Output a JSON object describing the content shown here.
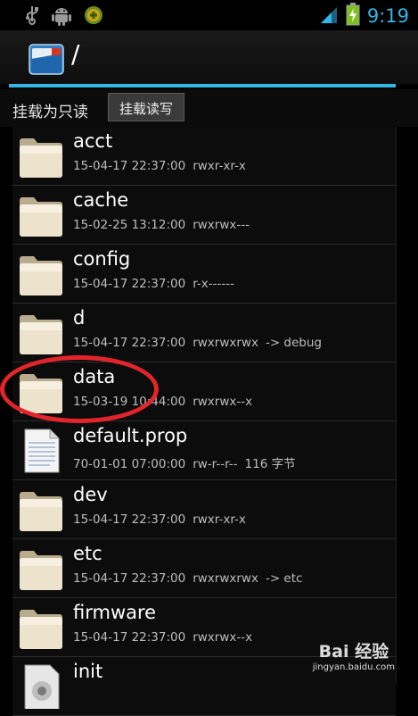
{
  "status_bar": {
    "time": "9:19",
    "left_icons": [
      "usb-icon",
      "android-debug-icon",
      "app-notification-icon"
    ],
    "right_icons": [
      "signal-icon",
      "battery-charging-icon"
    ]
  },
  "action_bar": {
    "path": "/",
    "accent": "#33b5e5"
  },
  "mount": {
    "label": "挂载为只读",
    "button": "挂载读写"
  },
  "files": [
    {
      "name": "acct",
      "date": "15-04-17 22:37:00",
      "perm": "rwxr-xr-x",
      "extra": "",
      "type": "folder"
    },
    {
      "name": "cache",
      "date": "15-02-25 13:12:00",
      "perm": "rwxrwx---",
      "extra": "",
      "type": "folder"
    },
    {
      "name": "config",
      "date": "15-04-17 22:37:00",
      "perm": "r-x------",
      "extra": "",
      "type": "folder"
    },
    {
      "name": "d",
      "date": "15-04-17 22:37:00",
      "perm": "rwxrwxrwx",
      "extra": "-> debug",
      "type": "folder"
    },
    {
      "name": "data",
      "date": "15-03-19 10:44:00",
      "perm": "rwxrwx--x",
      "extra": "",
      "type": "folder"
    },
    {
      "name": "default.prop",
      "date": "70-01-01 07:00:00",
      "perm": "rw-r--r--",
      "extra": "116 字节",
      "type": "file"
    },
    {
      "name": "dev",
      "date": "15-04-17 22:37:00",
      "perm": "rwxr-xr-x",
      "extra": "",
      "type": "folder"
    },
    {
      "name": "etc",
      "date": "15-04-17 22:37:00",
      "perm": "rwxrwxrwx",
      "extra": "-> etc",
      "type": "folder"
    },
    {
      "name": "firmware",
      "date": "15-04-17 22:37:00",
      "perm": "rwxrwx--x",
      "extra": "",
      "type": "folder"
    },
    {
      "name": "init",
      "date": "",
      "perm": "",
      "extra": "",
      "type": "binary"
    }
  ],
  "watermark": {
    "main": "Bai  经验",
    "sub": "jingyan.baidu.com"
  }
}
